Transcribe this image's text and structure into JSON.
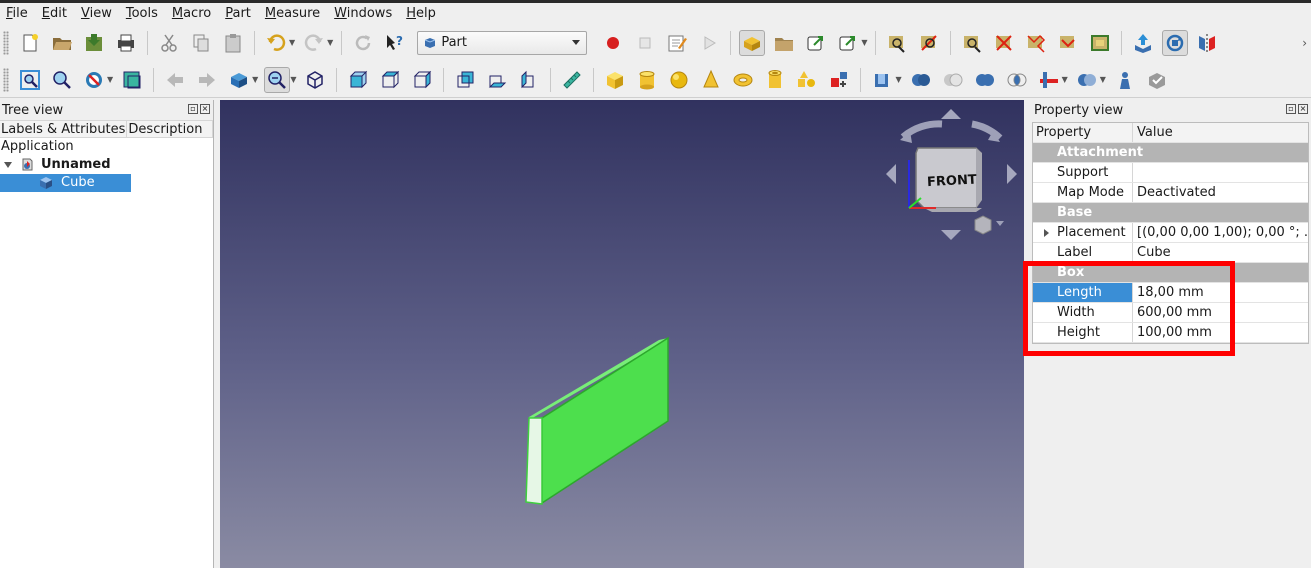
{
  "menu": [
    "File",
    "Edit",
    "View",
    "Tools",
    "Macro",
    "Part",
    "Measure",
    "Windows",
    "Help"
  ],
  "workbench": {
    "selected": "Part"
  },
  "toolbar_more": "›",
  "tree_view": {
    "title": "Tree view",
    "columns": [
      "Labels & Attributes",
      "Description"
    ],
    "section": "Application",
    "document": "Unnamed",
    "object": "Cube"
  },
  "navcube": {
    "face_label": "FRONT"
  },
  "property_view": {
    "title": "Property view",
    "columns": [
      "Property",
      "Value"
    ],
    "groups": [
      {
        "name": "Attachment",
        "rows": [
          {
            "name": "Support",
            "value": ""
          },
          {
            "name": "Map Mode",
            "value": "Deactivated"
          }
        ]
      },
      {
        "name": "Base",
        "rows": [
          {
            "name": "Placement",
            "value": "[(0,00 0,00 1,00); 0,00 °; ..."
          },
          {
            "name": "Label",
            "value": "Cube"
          }
        ]
      },
      {
        "name": "Box",
        "rows": [
          {
            "name": "Length",
            "value": "18,00 mm"
          },
          {
            "name": "Width",
            "value": "600,00 mm"
          },
          {
            "name": "Height",
            "value": "100,00 mm"
          }
        ]
      }
    ]
  },
  "colors": {
    "selection": "#3a8ed6",
    "object_green": "#4ddf4d",
    "highlight": "#ff0000"
  }
}
